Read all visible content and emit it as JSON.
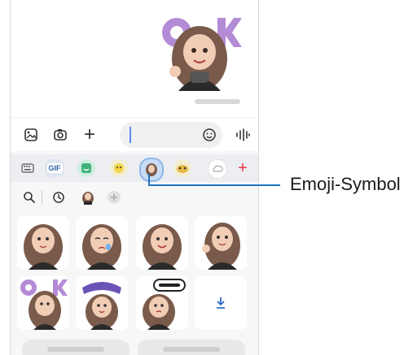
{
  "callout": {
    "label": "Emoji-Symbol"
  },
  "toolbar": {
    "gif_label": "GIF",
    "add_symbol": "+"
  },
  "composer": {
    "add_symbol": "+"
  },
  "sticker_grid": {
    "rows": 2,
    "items": [
      "girl-avatar-sticker",
      "girl-avatar-crying-sticker",
      "girl-avatar-sticker",
      "girl-avatar-sticker",
      "girl-avatar-ok-sticker",
      "girl-avatar-thanks-sticker",
      "girl-avatar-sorry-sticker",
      "download-icon"
    ]
  },
  "colors": {
    "accent_red": "#e9344a",
    "callout_blue": "#1d74bc",
    "caret_blue": "#5b8cf0"
  }
}
